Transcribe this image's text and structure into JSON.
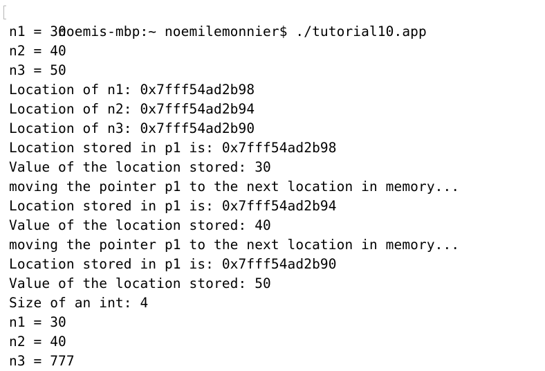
{
  "terminal": {
    "lines": [
      "noemis-mbp:~ noemilemonnier$ ./tutorial10.app",
      "n1 = 30",
      "n2 = 40",
      "n3 = 50",
      "Location of n1: 0x7fff54ad2b98",
      "Location of n2: 0x7fff54ad2b94",
      "Location of n3: 0x7fff54ad2b90",
      "Location stored in p1 is: 0x7fff54ad2b98",
      "Value of the location stored: 30",
      "moving the pointer p1 to the next location in memory...",
      "Location stored in p1 is: 0x7fff54ad2b94",
      "Value of the location stored: 40",
      "moving the pointer p1 to the next location in memory...",
      "Location stored in p1 is: 0x7fff54ad2b90",
      "Value of the location stored: 50",
      "Size of an int: 4",
      "n1 = 30",
      "n2 = 40",
      "n3 = 777"
    ]
  }
}
